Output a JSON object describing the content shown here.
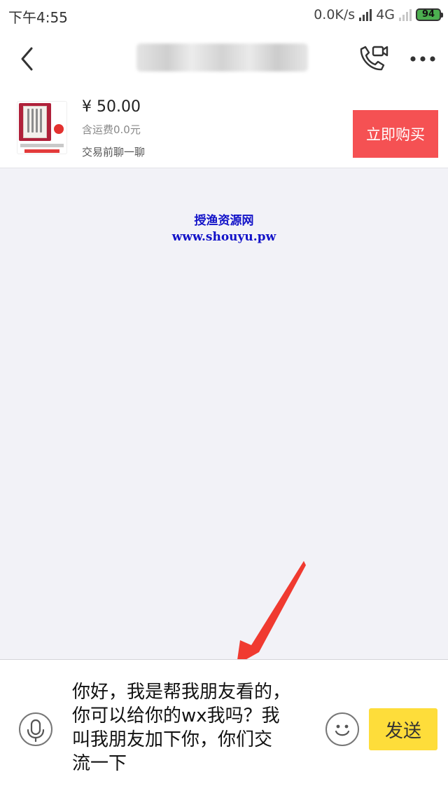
{
  "status_bar": {
    "time": "下午4:55",
    "network_speed": "0.0K/s",
    "network_type": "4G",
    "battery": "94"
  },
  "nav": {
    "title": "██████████",
    "back_icon": "chevron-left-icon",
    "call_icon": "phone-video-icon",
    "more_icon": "more-dots-icon"
  },
  "product": {
    "price": "¥ 50.00",
    "shipping": "含运费0.0元",
    "chat_hint": "交易前聊一聊",
    "buy_label": "立即购买"
  },
  "watermark": {
    "title": "授渔资源网",
    "url": "www.shouyu.pw"
  },
  "input_bar": {
    "message": "你好，我是帮我朋友看的，\n你可以给你的wx我吗？我\n叫我朋友加下你，你们交\n流一下",
    "send_label": "发送",
    "voice_icon": "microphone-icon",
    "emoji_icon": "emoji-icon"
  },
  "colors": {
    "buy_button": "#f55153",
    "send_button": "#fedd3a",
    "chat_background": "#f2f2f7",
    "arrow": "#f03a30",
    "watermark": "#1212c8"
  }
}
